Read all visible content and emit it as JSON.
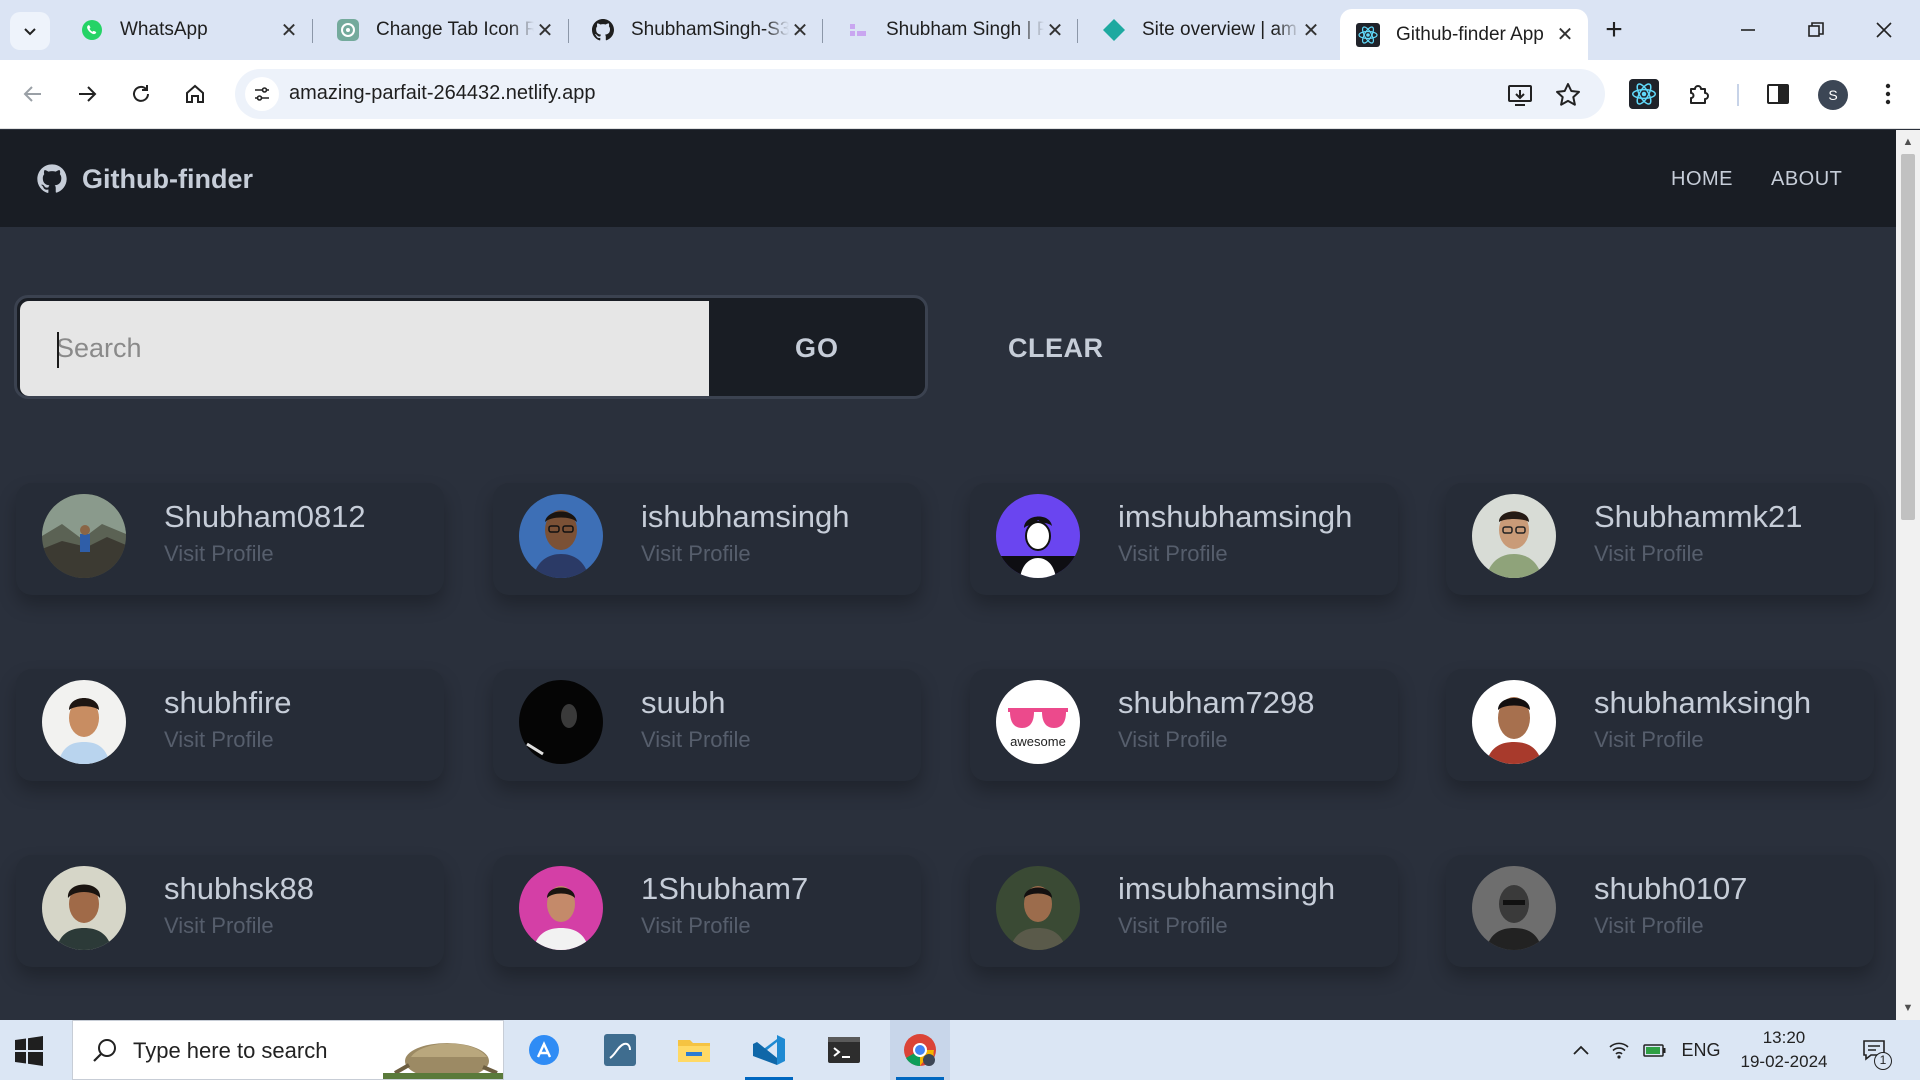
{
  "browser": {
    "tabs": [
      {
        "title": "WhatsApp",
        "icon": "whatsapp-icon",
        "active": false
      },
      {
        "title": "Change Tab Icon R",
        "icon": "chatgpt-icon",
        "active": false
      },
      {
        "title": "ShubhamSingh-S3",
        "icon": "github-icon",
        "active": false
      },
      {
        "title": "Shubham Singh | P",
        "icon": "portfolio-icon",
        "active": false
      },
      {
        "title": "Site overview | am",
        "icon": "netlify-icon",
        "active": false
      },
      {
        "title": "Github-finder App",
        "icon": "react-icon",
        "active": true
      }
    ],
    "url": "amazing-parfait-264432.netlify.app",
    "profile_initial": "S"
  },
  "app": {
    "brand": "Github-finder",
    "nav": {
      "home": "HOME",
      "about": "ABOUT"
    },
    "search": {
      "placeholder": "Search",
      "go": "GO",
      "clear": "CLEAR"
    },
    "users": [
      {
        "login": "Shubham0812",
        "link": "Visit Profile"
      },
      {
        "login": "ishubhamsingh",
        "link": "Visit Profile"
      },
      {
        "login": "imshubhamsingh",
        "link": "Visit Profile"
      },
      {
        "login": "Shubhammk21",
        "link": "Visit Profile"
      },
      {
        "login": "shubhfire",
        "link": "Visit Profile"
      },
      {
        "login": "suubh",
        "link": "Visit Profile"
      },
      {
        "login": "shubham7298",
        "link": "Visit Profile"
      },
      {
        "login": "shubhamksingh",
        "link": "Visit Profile"
      },
      {
        "login": "shubhsk88",
        "link": "Visit Profile"
      },
      {
        "login": "1Shubham7",
        "link": "Visit Profile"
      },
      {
        "login": "imsubhamsingh",
        "link": "Visit Profile"
      },
      {
        "login": "shubh0107",
        "link": "Visit Profile"
      }
    ],
    "avatar_text": {
      "shubham7298": "awesome"
    }
  },
  "taskbar": {
    "search_placeholder": "Type here to search",
    "language": "ENG",
    "time": "13:20",
    "date": "19-02-2024",
    "notification_count": "1",
    "apps": [
      "app-store-icon",
      "mysql-workbench-icon",
      "file-explorer-icon",
      "vscode-icon",
      "terminal-icon",
      "chrome-icon"
    ]
  },
  "colors": {
    "page_bg": "#2a303c",
    "navbar_bg": "#191d24",
    "card_bg": "#262c37",
    "text": "#c6cdd8",
    "muted": "#565e6c",
    "input_bg": "#e6e6e6"
  }
}
